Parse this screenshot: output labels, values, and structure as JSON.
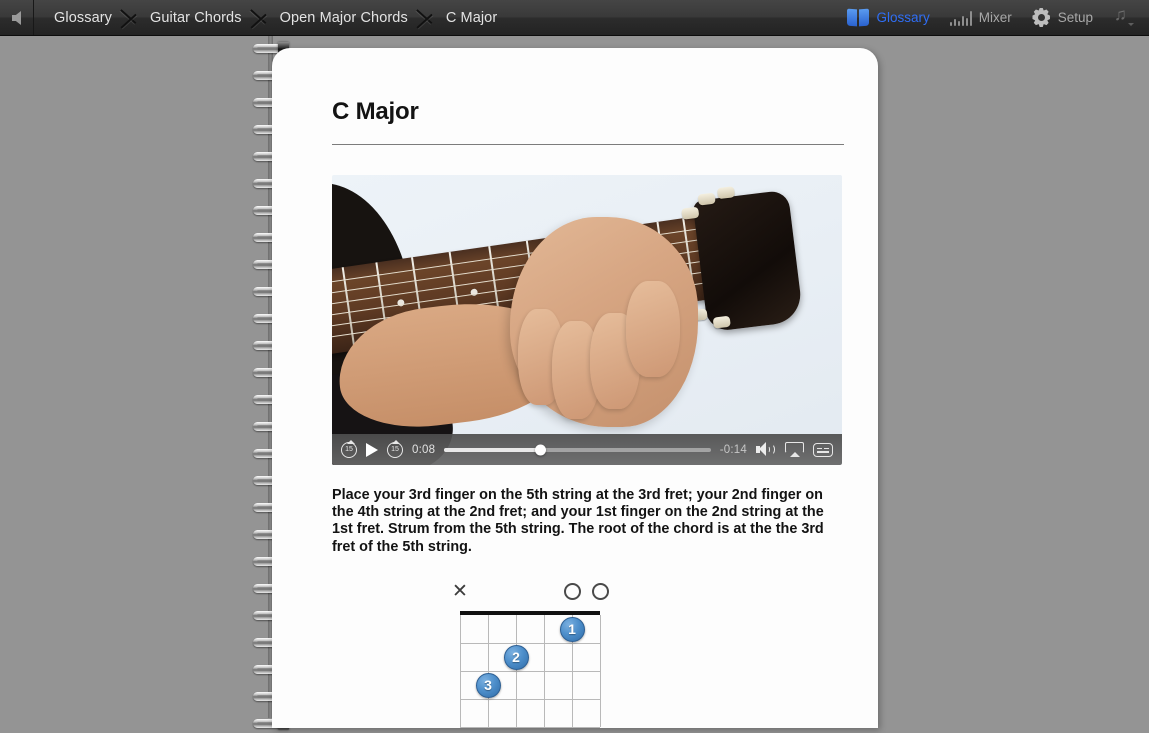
{
  "toolbar": {
    "back_icon": "back-arrow-icon",
    "breadcrumbs": [
      {
        "label": "Glossary"
      },
      {
        "label": "Guitar Chords"
      },
      {
        "label": "Open Major Chords"
      },
      {
        "label": "C Major"
      }
    ],
    "right_items": [
      {
        "label": "Glossary",
        "icon": "book-icon",
        "active": true
      },
      {
        "label": "Mixer",
        "icon": "mixer-icon",
        "active": false
      },
      {
        "label": "Setup",
        "icon": "gear-icon",
        "active": false
      }
    ],
    "note_menu_icon": "music-note-icon",
    "accent_color": "#2f6ef5",
    "background_color": "#333333"
  },
  "page": {
    "title": "C Major",
    "body_text": "Place your 3rd finger on the 5th string at the 3rd fret; your 2nd finger on the 4th string at the 2nd fret; and your 1st finger on the 2nd string at the 1st fret. Strum from the 5th string. The root of the chord is at the the 3rd fret of the 5th string.",
    "background_color": "#fdfdfd"
  },
  "video": {
    "description": "Hand fretting a C major chord on an acoustic guitar neck",
    "current_time": "0:08",
    "remaining_time": "-0:14",
    "progress_percent": 36,
    "controls": [
      {
        "name": "rewind-15-button",
        "label": "15"
      },
      {
        "name": "play-button",
        "label": ""
      },
      {
        "name": "forward-15-button",
        "label": "15"
      },
      {
        "name": "volume-button",
        "label": ""
      },
      {
        "name": "airplay-button",
        "label": ""
      },
      {
        "name": "subtitles-button",
        "label": ""
      }
    ]
  },
  "chord_diagram": {
    "name": "C Major",
    "strings": 6,
    "frets": 4,
    "string_markers": [
      "X",
      "",
      "",
      "",
      "O",
      "O"
    ],
    "fingerings": [
      {
        "finger": "1",
        "string": 2,
        "fret": 1
      },
      {
        "finger": "2",
        "string": 4,
        "fret": 2
      },
      {
        "finger": "3",
        "string": 5,
        "fret": 3
      }
    ],
    "dot_color": "#4e8fcb"
  }
}
